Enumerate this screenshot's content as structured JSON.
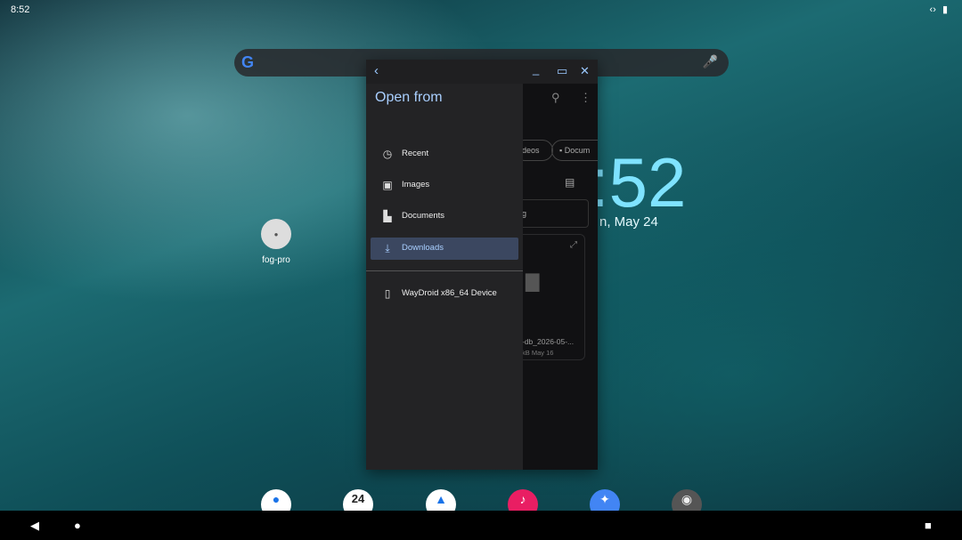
{
  "status_bar": {
    "time": "8:52",
    "icons": [
      "code-icon",
      "battery-icon"
    ]
  },
  "home": {
    "clock_fragment": ":52",
    "date_fragment": "n, May 24",
    "app_label": "fog-pro"
  },
  "window": {
    "title": "Open from",
    "controls": [
      "back-icon",
      "minimize-icon",
      "maximize-icon",
      "close-icon"
    ],
    "nav_items": [
      {
        "label": "Recent",
        "icon": "clock-icon"
      },
      {
        "label": "Images",
        "icon": "image-icon"
      },
      {
        "label": "Documents",
        "icon": "document-icon"
      },
      {
        "label": "Downloads",
        "icon": "download-icon",
        "active": true
      },
      {
        "label": "WayDroid x86_64 Device",
        "icon": "device-icon"
      }
    ],
    "behind": {
      "chip_videos": "deos",
      "chip_documents": "Docum",
      "field_fragment": "g",
      "file_name": "-db_2026-05-...",
      "file_meta": "kB May 16"
    }
  },
  "dock": {
    "calendar_day": "24"
  },
  "colors": {
    "accent": "#a9cfff",
    "active_item_bg": "#3b4760",
    "clock_color": "#7fe3ff"
  }
}
